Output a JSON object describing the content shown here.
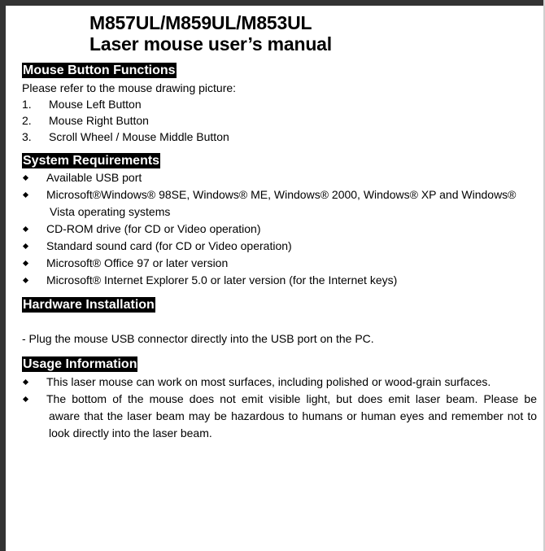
{
  "document": {
    "title_line1": "M857UL/M859UL/M853UL",
    "title_line2": "Laser mouse user’s manual"
  },
  "sections": {
    "mouse_buttons": {
      "header": "Mouse Button Functions",
      "intro": "Please refer to the mouse drawing picture:",
      "items": [
        {
          "num": "1.",
          "text": "Mouse Left Button"
        },
        {
          "num": "2.",
          "text": "Mouse Right Button"
        },
        {
          "num": "3.",
          "text": "Scroll Wheel / Mouse Middle Button"
        }
      ]
    },
    "system_requirements": {
      "header": "System Requirements",
      "items": [
        {
          "text": "Available USB port"
        },
        {
          "text": "Microsoft®Windows® 98SE, Windows® ME, Windows® 2000, Windows® XP and Windows®",
          "continuation": "Vista operating systems"
        },
        {
          "text": "CD-ROM drive (for CD or Video operation)"
        },
        {
          "text": "Standard sound card (for CD or Video operation)"
        },
        {
          "text": "Microsoft® Office 97 or later version"
        },
        {
          "text": "Microsoft® Internet Explorer 5.0 or later version (for the Internet keys)"
        }
      ]
    },
    "hardware_installation": {
      "header": "Hardware Installation",
      "text": "- Plug the mouse USB connector directly into the USB port on the PC."
    },
    "usage_information": {
      "header": "Usage Information",
      "items": [
        {
          "lines": [
            "This laser mouse can work on most surfaces, including polished or wood-grain surfaces."
          ]
        },
        {
          "lines": [
            "The bottom of the mouse does not emit visible light, but does emit laser beam. Please be",
            "aware that the laser beam may be hazardous to humans or human eyes and remember not to",
            "look directly into the laser beam."
          ]
        }
      ]
    }
  }
}
